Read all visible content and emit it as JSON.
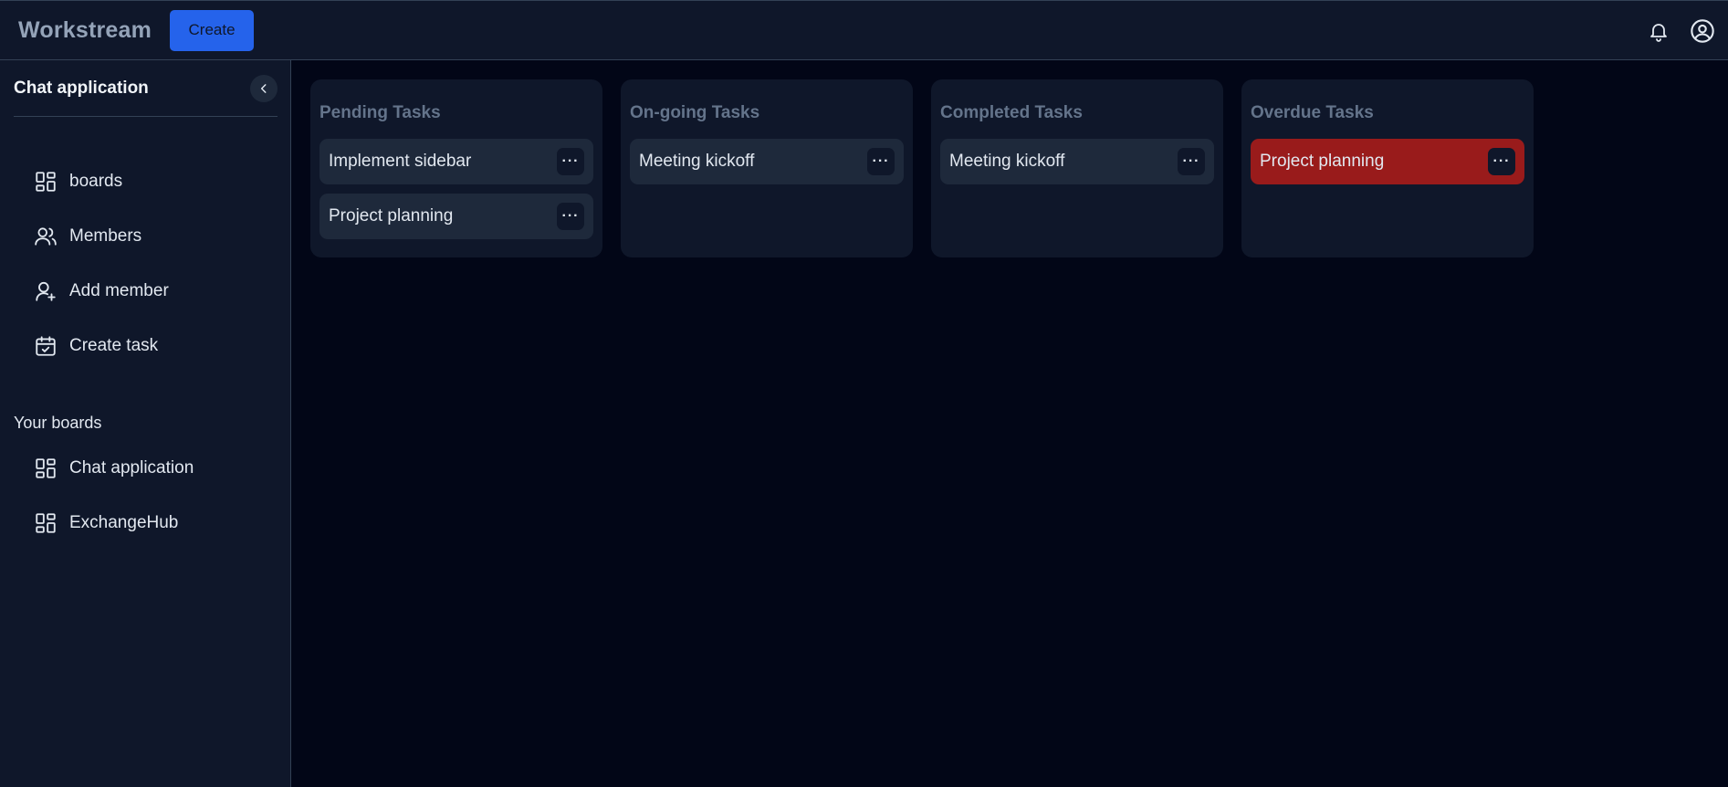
{
  "header": {
    "brand": "Workstream",
    "create_label": "Create",
    "icons": [
      "bell-icon",
      "user-circle-icon"
    ]
  },
  "sidebar": {
    "board_title": "Chat application",
    "nav": [
      {
        "label": "boards",
        "icon": "grid-icon"
      },
      {
        "label": "Members",
        "icon": "users-icon"
      },
      {
        "label": "Add member",
        "icon": "user-plus-icon"
      },
      {
        "label": "Create task",
        "icon": "calendar-check-icon"
      }
    ],
    "boards_heading": "Your boards",
    "boards": [
      {
        "label": "Chat application",
        "icon": "grid-icon"
      },
      {
        "label": "ExchangeHub",
        "icon": "grid-icon"
      }
    ]
  },
  "columns": [
    {
      "title": "Pending Tasks",
      "cards": [
        "Implement sidebar",
        "Project planning"
      ]
    },
    {
      "title": "On-going Tasks",
      "cards": [
        "Meeting kickoff"
      ]
    },
    {
      "title": "Completed Tasks",
      "cards": [
        "Meeting kickoff"
      ]
    },
    {
      "title": "Overdue Tasks",
      "cards": [
        "Project planning"
      ]
    }
  ],
  "menu_glyph": "···",
  "colors": {
    "background": "#020617",
    "panel": "#0f172a",
    "card": "#1e293b",
    "accent": "#2563eb",
    "overdue": "#991b1b"
  }
}
